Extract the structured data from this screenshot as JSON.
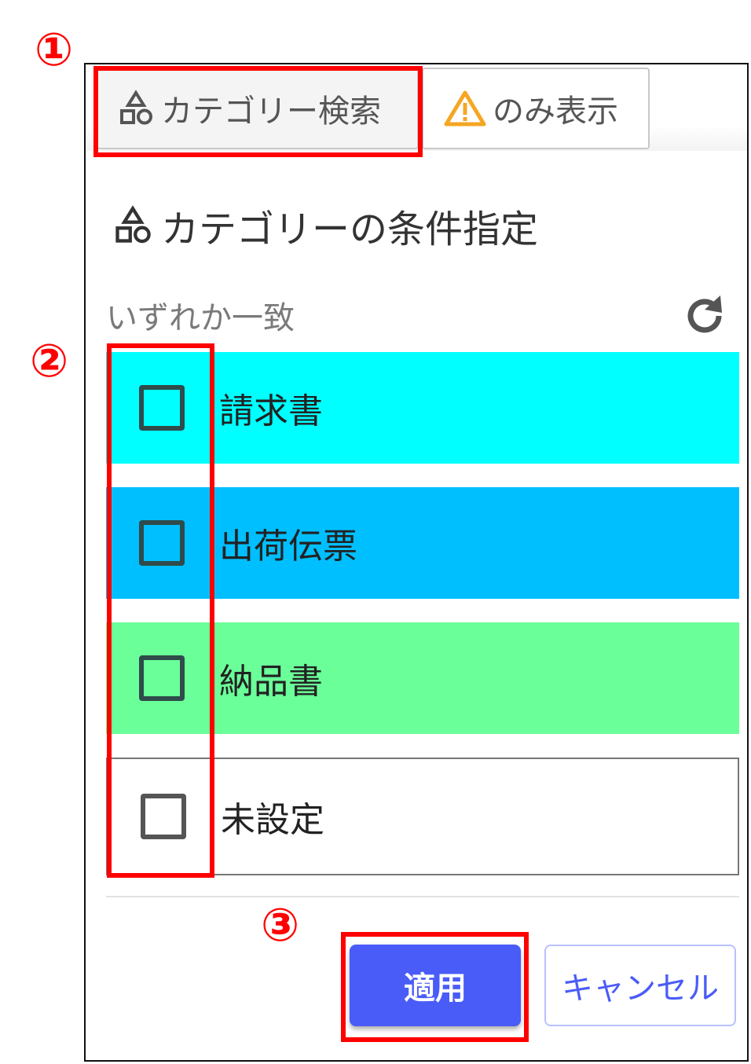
{
  "tabs": [
    {
      "label": "カテゴリー検索",
      "icon": "shapes-icon"
    },
    {
      "label": "のみ表示",
      "icon": "warning-icon"
    }
  ],
  "section": {
    "title": "カテゴリーの条件指定",
    "icon": "shapes-icon"
  },
  "match_mode": "いずれか一致",
  "categories": [
    {
      "label": "請求書",
      "color": "#00ffff",
      "checked": false
    },
    {
      "label": "出荷伝票",
      "color": "#00bfff",
      "checked": false
    },
    {
      "label": "納品書",
      "color": "#6bff99",
      "checked": false
    },
    {
      "label": "未設定",
      "color": "#ffffff",
      "checked": false
    }
  ],
  "buttons": {
    "apply": "適用",
    "cancel": "キャンセル"
  },
  "annotations": [
    "①",
    "②",
    "③"
  ],
  "colors": {
    "accent": "#4a5cf7",
    "annotation": "#ff0000"
  }
}
